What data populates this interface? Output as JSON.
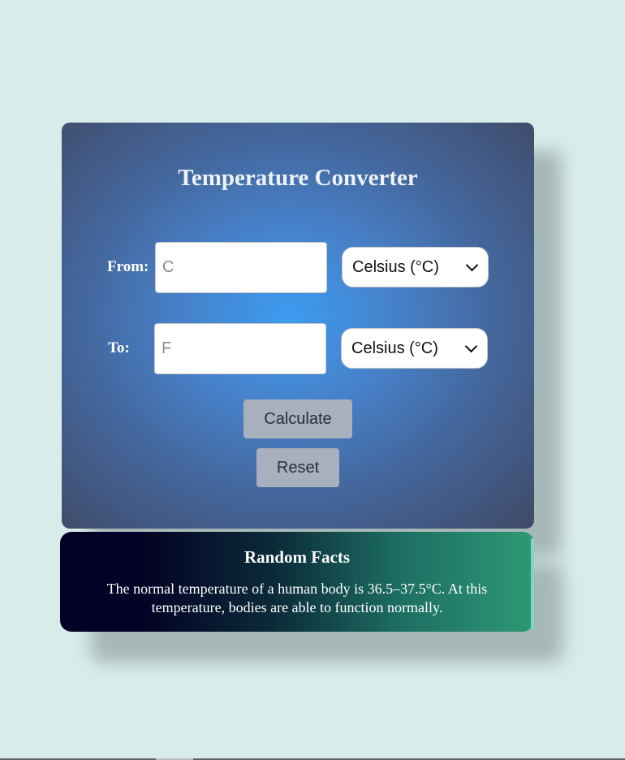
{
  "converter": {
    "title": "Temperature Converter",
    "from": {
      "label": "From:",
      "placeholder": "C",
      "value": "",
      "unit_selected": "Celsius (°C)"
    },
    "to": {
      "label": "To:",
      "placeholder": "F",
      "value": "",
      "unit_selected": "Celsius (°C)"
    },
    "calculate_label": "Calculate",
    "reset_label": "Reset"
  },
  "facts": {
    "title": "Random Facts",
    "text": "The normal temperature of a human body is 36.5–37.5°C. At this temperature, bodies are able to function normally."
  },
  "colors": {
    "page_background": "#d8ecea",
    "panel_center": "#3d9bf0",
    "panel_edge": "#3f4a66",
    "button": "#a9b0bd",
    "facts_start": "#020024",
    "facts_end": "#2e9874"
  },
  "icons": {
    "select_arrow": "chevron-down-icon"
  }
}
